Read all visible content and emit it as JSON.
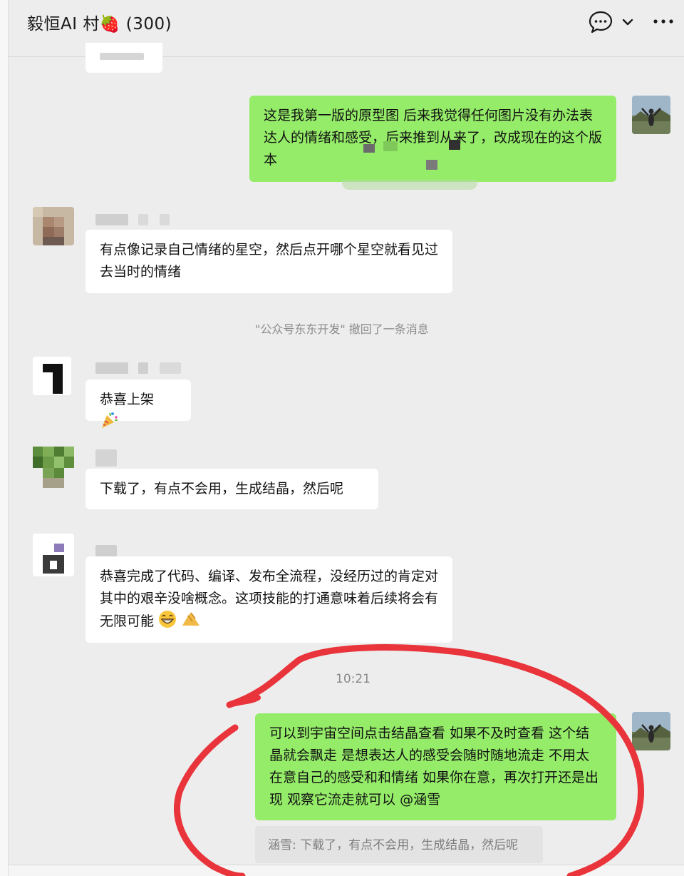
{
  "header": {
    "title": "毅恒AI 村🍓 (300)",
    "chat_icon": "chat-bubble-icon",
    "chevron_icon": "chevron-down-icon",
    "more_icon": "more-dots-icon"
  },
  "messages": {
    "m1": "这是我第一版的原型图 后来我觉得任何图片没有办法表达人的情绪和感受，后来推到从来了，改成现在的这个版本",
    "m2": "有点像记录自己情绪的星空，然后点开哪个星空就看见过去当时的情绪",
    "system": "\"公众号东东开发\" 撤回了一条消息",
    "m3": "恭喜上架",
    "m4": "下载了，有点不会用，生成结晶，然后呢",
    "m5": "恭喜完成了代码、编译、发布全流程，没经历过的肯定对其中的艰辛没啥概念。这项技能的打通意味着后续将会有无限可能",
    "time": "10:21",
    "m6": "可以到宇宙空间点击结晶查看  如果不及时查看  这个结晶就会飘走 是想表达人的感受会随时随地流走  不用太在意自己的感受和和情绪  如果你在意，再次打开还是出现   观察它流走就可以 @涵雪",
    "quote": "涵雪: 下载了，有点不会用，生成结晶，然后呢"
  },
  "colors": {
    "accent_green": "#95ec69",
    "annotation_red": "#e8343a",
    "background": "#ededed"
  }
}
